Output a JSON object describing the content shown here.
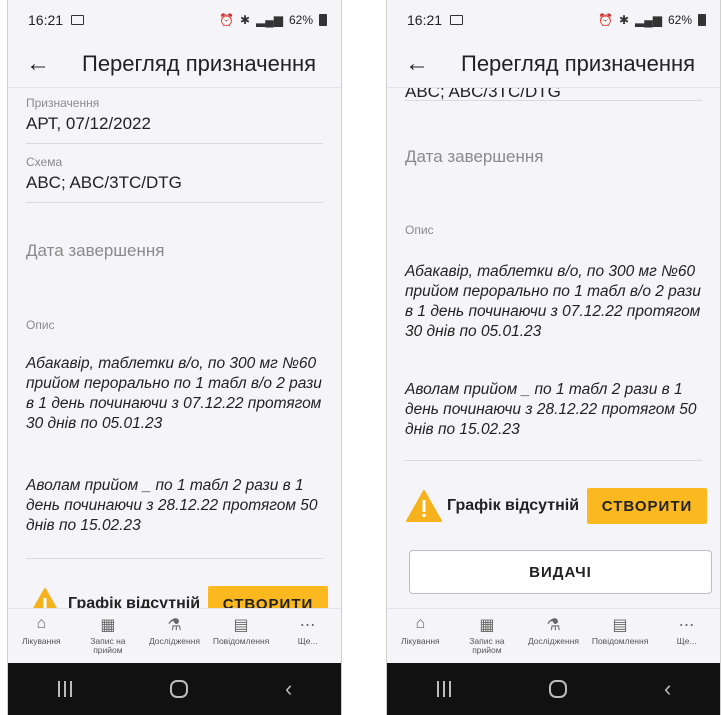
{
  "status": {
    "time": "16:21",
    "battery": "62%"
  },
  "appbar": {
    "title": "Перегляд призначення"
  },
  "fields": {
    "assignment_label": "Призначення",
    "assignment_value": "АРТ, 07/12/2022",
    "scheme_label": "Схема",
    "scheme_value": "ABC; ABC/3TC/DTG",
    "scheme_value_clipped": "ABC; ABC/3TC/DTG",
    "end_date_placeholder": "Дата завершення",
    "description_label": "Опис",
    "description_1": "Абакавір, таблетки в/о, по 300 мг №60 прийом перорально по 1 табл в/о 2 рази в 1 день починаючи з 07.12.22 протягом 30 днів по 05.01.23",
    "description_2": "Аволам прийом _ по 1 табл 2 рази в 1 день починаючи з 28.12.22 протягом 50 днів по 15.02.23"
  },
  "schedule": {
    "missing_text": "Графік відсутній",
    "create_label": "СТВОРИТИ"
  },
  "issues_label": "ВИДАЧІ",
  "nav": [
    {
      "label": "Лікування",
      "icon": "home-icon"
    },
    {
      "label": "Запис на прийом",
      "icon": "calendar-icon"
    },
    {
      "label": "Дослідження",
      "icon": "flask-icon"
    },
    {
      "label": "Повідомлення",
      "icon": "message-icon"
    },
    {
      "label": "Ще...",
      "icon": "more-icon"
    }
  ],
  "colors": {
    "accent": "#fbb91f",
    "warning": "#f5b21c",
    "background": "#f5f5f9"
  }
}
